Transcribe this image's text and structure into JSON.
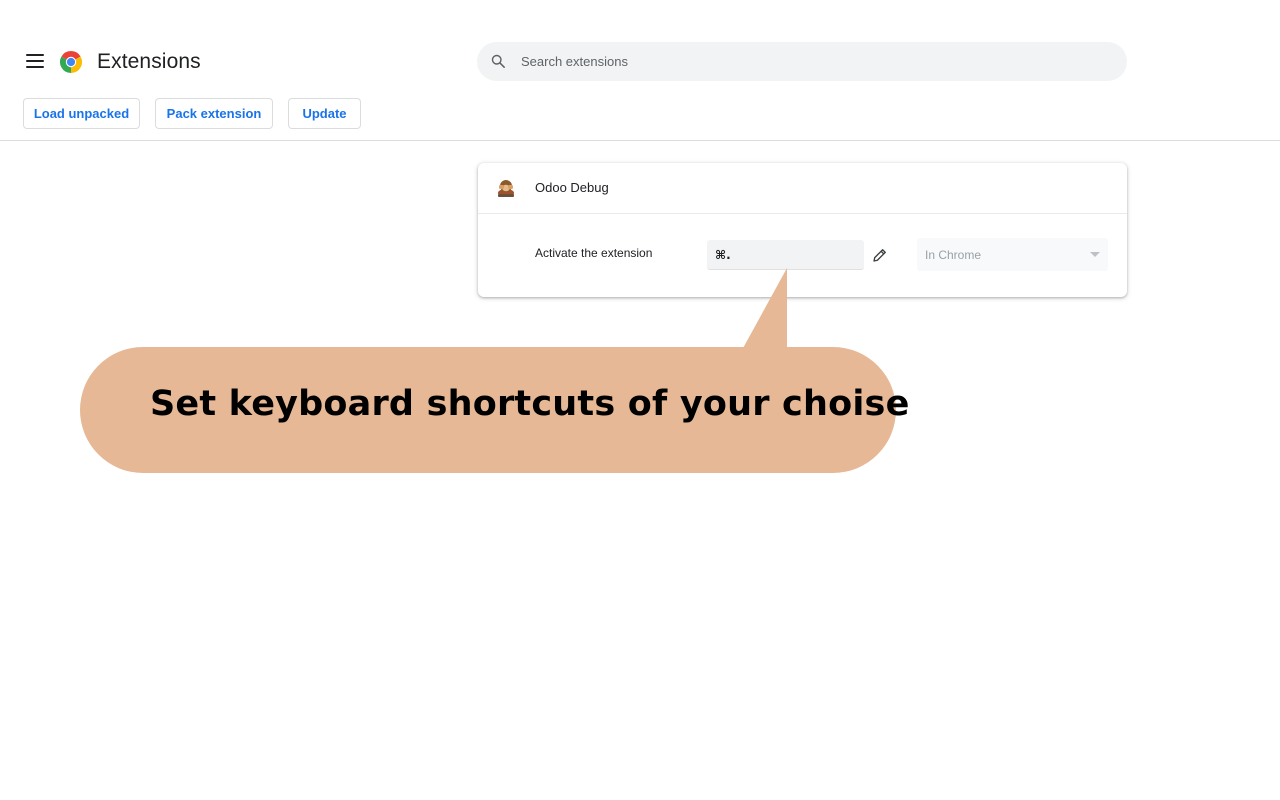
{
  "header": {
    "title": "Extensions",
    "menu_icon": "hamburger-menu-icon",
    "logo_icon": "chrome-logo-icon"
  },
  "search": {
    "placeholder": "Search extensions",
    "value": "",
    "icon": "search-icon"
  },
  "toolbar": {
    "load_unpacked_label": "Load unpacked",
    "pack_extension_label": "Pack extension",
    "update_label": "Update"
  },
  "extension": {
    "name": "Odoo Debug",
    "icon": "odoo-monkey-icon",
    "shortcut": {
      "label": "Activate the extension",
      "value": "⌘.",
      "edit_icon": "pencil-icon",
      "scope": "In Chrome"
    }
  },
  "callout": {
    "text": "Set keyboard shortcuts of your choise"
  },
  "colors": {
    "accent_blue": "#1a73e8",
    "callout_background": "#e6b895",
    "search_background": "#f1f3f4",
    "text_primary": "#202124",
    "text_disabled": "#9aa0a6"
  }
}
